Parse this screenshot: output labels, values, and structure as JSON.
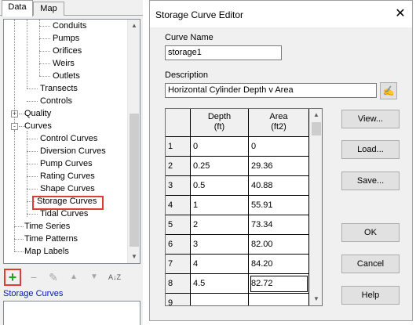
{
  "left_panel": {
    "tabs": [
      {
        "label": "Data",
        "active": true
      },
      {
        "label": "Map",
        "active": false
      }
    ],
    "tree": [
      {
        "label": "Conduits",
        "level": 3
      },
      {
        "label": "Pumps",
        "level": 3
      },
      {
        "label": "Orifices",
        "level": 3
      },
      {
        "label": "Weirs",
        "level": 3
      },
      {
        "label": "Outlets",
        "level": 3
      },
      {
        "label": "Transects",
        "level": 2
      },
      {
        "label": "Controls",
        "level": 2
      },
      {
        "label": "Quality",
        "level": 1,
        "expander": "+"
      },
      {
        "label": "Curves",
        "level": 1,
        "expander": "-"
      },
      {
        "label": "Control Curves",
        "level": 2
      },
      {
        "label": "Diversion Curves",
        "level": 2
      },
      {
        "label": "Pump Curves",
        "level": 2
      },
      {
        "label": "Rating Curves",
        "level": 2
      },
      {
        "label": "Shape Curves",
        "level": 2
      },
      {
        "label": "Storage Curves",
        "level": 2,
        "highlighted": true
      },
      {
        "label": "Tidal Curves",
        "level": 2
      },
      {
        "label": "Time Series",
        "level": 1
      },
      {
        "label": "Time Patterns",
        "level": 1
      },
      {
        "label": "Map Labels",
        "level": 1
      }
    ],
    "toolbar": {
      "add_icon": "+",
      "delete_icon": "−",
      "edit_icon": "✎",
      "up_icon": "▲",
      "down_icon": "▼",
      "sort_icon": "A↓Z"
    },
    "selected_type_label": "Storage Curves"
  },
  "dialog": {
    "title": "Storage Curve Editor",
    "close_icon": "✕",
    "curve_name_label": "Curve Name",
    "curve_name_value": "storage1",
    "description_label": "Description",
    "description_value": "Horizontal Cylinder Depth v Area",
    "browse_icon": "✍",
    "grid": {
      "col1_header_line1": "Depth",
      "col1_header_line2": "(ft)",
      "col2_header_line1": "Area",
      "col2_header_line2": "(ft2)",
      "rows": [
        {
          "num": "1",
          "depth": "0",
          "area": "0"
        },
        {
          "num": "2",
          "depth": "0.25",
          "area": "29.36"
        },
        {
          "num": "3",
          "depth": "0.5",
          "area": "40.88"
        },
        {
          "num": "4",
          "depth": "1",
          "area": "55.91"
        },
        {
          "num": "5",
          "depth": "2",
          "area": "73.34"
        },
        {
          "num": "6",
          "depth": "3",
          "area": "82.00"
        },
        {
          "num": "7",
          "depth": "4",
          "area": "84.20"
        },
        {
          "num": "8",
          "depth": "4.5",
          "area": "82.72"
        },
        {
          "num": "9",
          "depth": "",
          "area": ""
        }
      ]
    },
    "buttons": {
      "view": "View...",
      "load": "Load...",
      "save": "Save...",
      "ok": "OK",
      "cancel": "Cancel",
      "help": "Help"
    }
  }
}
